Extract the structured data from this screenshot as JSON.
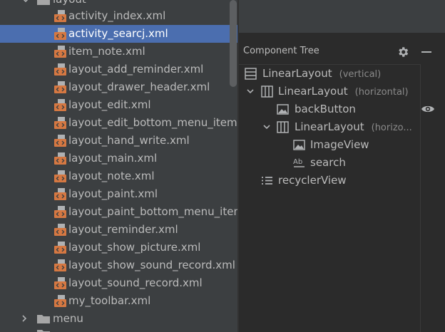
{
  "project_tree": {
    "folder_layout": "layout",
    "files": [
      "activity_index.xml",
      "activity_searcj.xml",
      "item_note.xml",
      "layout_add_reminder.xml",
      "layout_drawer_header.xml",
      "layout_edit.xml",
      "layout_edit_bottom_menu_item.xml",
      "layout_hand_write.xml",
      "layout_main.xml",
      "layout_note.xml",
      "layout_paint.xml",
      "layout_paint_bottom_menu_item.xml",
      "layout_reminder.xml",
      "layout_show_picture.xml",
      "layout_show_sound_record.xml",
      "layout_sound_record.xml",
      "my_toolbar.xml"
    ],
    "selected_file": "activity_searcj.xml",
    "folder_menu": "menu"
  },
  "component_tree": {
    "title": "Component Tree",
    "nodes": [
      {
        "label": "LinearLayout",
        "sub": "(vertical)"
      },
      {
        "label": "LinearLayout",
        "sub": "(horizontal)"
      },
      {
        "label": "backButton",
        "sub": ""
      },
      {
        "label": "LinearLayout",
        "sub": "(horizo..."
      },
      {
        "label": "ImageView",
        "sub": ""
      },
      {
        "label": "search",
        "sub": ""
      },
      {
        "label": "recyclerView",
        "sub": ""
      }
    ]
  },
  "colors": {
    "selection": "#4b6eaf",
    "xml_icon": "#d57842",
    "panel_bg": "#3c3f41",
    "editor_bg": "#2b2b2b"
  },
  "icons": {
    "xml_file": "xml-file-icon",
    "folder": "folder-icon",
    "linear_layout_vertical": "linear-layout-vertical-icon",
    "linear_layout_horizontal": "linear-layout-horizontal-icon",
    "image": "image-icon",
    "text": "text-icon",
    "list": "list-icon",
    "gear": "gear-icon",
    "eye": "eye-icon"
  }
}
